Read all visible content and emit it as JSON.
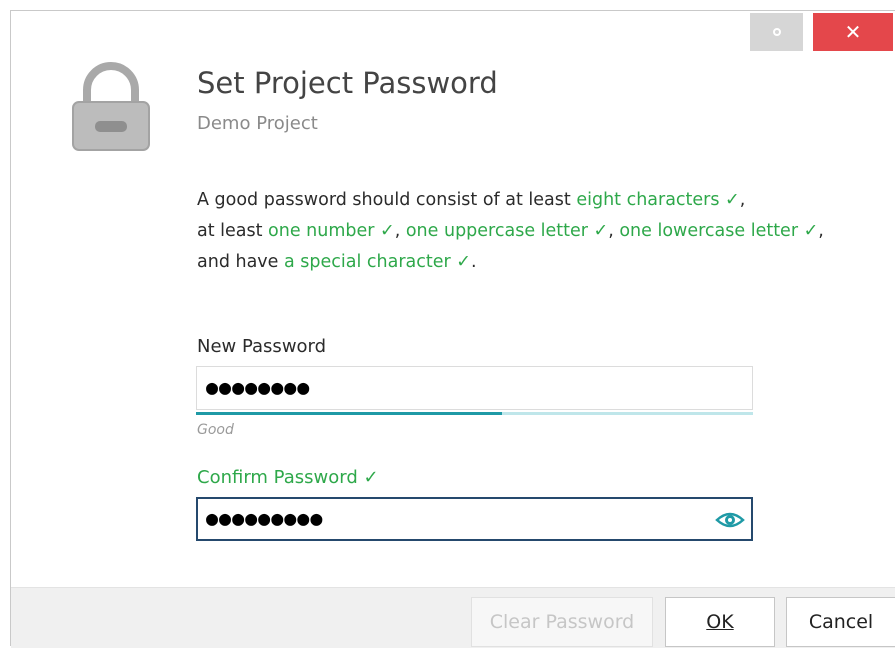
{
  "window": {
    "settings_icon": "circle-icon",
    "close_icon": "close-icon",
    "close_glyph": "✕"
  },
  "header": {
    "title": "Set Project Password",
    "subtitle": "Demo Project",
    "icon": "lock-icon"
  },
  "requirements": {
    "prefix": "A good password should consist of at least ",
    "eight_chars": "eight characters ✓",
    "sep1": ",",
    "line2_prefix": "at least ",
    "one_number": "one number ✓",
    "sep2": ", ",
    "one_upper": "one uppercase letter ✓",
    "sep3": ", ",
    "one_lower": "one lowercase letter ✓",
    "sep4": ", and have ",
    "special": "a special character ✓",
    "end": "."
  },
  "new_password": {
    "label": "New Password",
    "masked_value": "●●●●●●●●",
    "strength_label": "Good",
    "strength_fraction": 0.55
  },
  "confirm_password": {
    "label": "Confirm Password ✓",
    "masked_value": "●●●●●●●●●",
    "reveal_icon": "eye-icon"
  },
  "buttons": {
    "clear_label": "Clear Password",
    "ok_label": "OK",
    "cancel_label": "Cancel"
  },
  "colors": {
    "accent_green": "#2ea84a",
    "close_red": "#e4474b",
    "strength_fill": "#1f9aa6",
    "focus_border": "#25496d"
  }
}
